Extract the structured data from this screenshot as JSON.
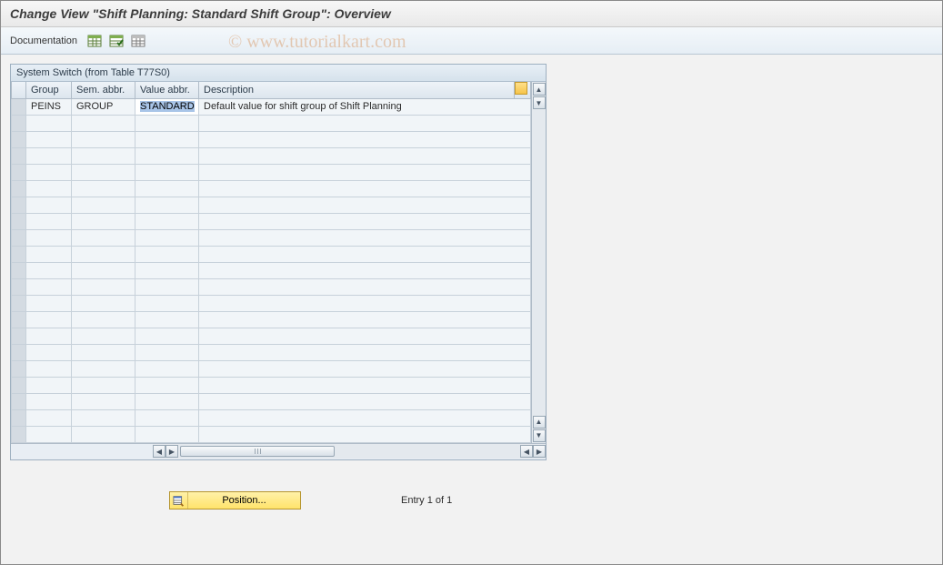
{
  "title": "Change View \"Shift Planning: Standard Shift Group\": Overview",
  "toolbar": {
    "documentation_label": "Documentation"
  },
  "panel": {
    "title": "System Switch (from Table T77S0)"
  },
  "grid": {
    "headers": {
      "group": "Group",
      "sem_abbr": "Sem. abbr.",
      "value_abbr": "Value abbr.",
      "description": "Description"
    },
    "rows": [
      {
        "group": "PEINS",
        "sem_abbr": "GROUP",
        "value_abbr": "STANDARD",
        "description": "Default value for shift group of Shift Planning"
      }
    ],
    "empty_row_count": 20
  },
  "footer": {
    "position_label": "Position...",
    "entry_label": "Entry 1 of 1"
  },
  "watermark": "© www.tutorialkart.com"
}
